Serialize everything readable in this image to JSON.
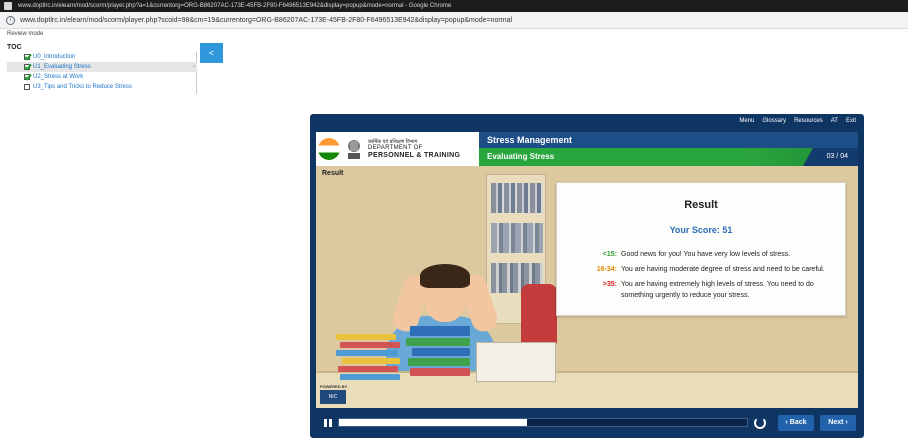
{
  "browser": {
    "window_title": "www.doptlrc.in/elearn/mod/scorm/player.php?a=1&currentorg=ORG-B86207AC-173E-45FB-2F80-F6496513E942&display=popup&mode=normal - Google Chrome",
    "url": "www.doptlrc.in/elearn/mod/scorm/player.php?scoid=98&cm=19&currentorg=ORG-B86207AC-173E-45FB-2F80-F6496513E942&display=popup&mode=normal"
  },
  "review_mode": "Review mode",
  "toc": {
    "heading": "TOC",
    "collapse_label": "<",
    "items": [
      {
        "label": "U0_Introduction",
        "checked": true
      },
      {
        "label": "U1_Evaluating Stress",
        "checked": true
      },
      {
        "label": "U2_Stress at Work",
        "checked": true
      },
      {
        "label": "U3_Tips and Tricks to Reduce Stress",
        "checked": false
      }
    ]
  },
  "player": {
    "nav": [
      "Menu",
      "Glossary",
      "Resources",
      "AT",
      "Exit"
    ],
    "dept_hindi": "कार्मिक एवं प्रशिक्षण विभाग",
    "dept_line1": "DEPARTMENT OF",
    "dept_line2": "PERSONNEL & TRAINING",
    "course_title": "Stress Management",
    "topic_title": "Evaluating Stress",
    "page_counter": "03 / 04",
    "stage_label": "Result",
    "result": {
      "title": "Result",
      "score_label": "Your Score:",
      "score_value": "51",
      "ranges": [
        {
          "range": "<15:",
          "color": "#2e9e2e",
          "text": "Good news for you! You have very low levels of stress."
        },
        {
          "range": "16-34:",
          "color": "#e08a00",
          "text": "You are having moderate degree of stress and need to be careful."
        },
        {
          "range": ">35:",
          "color": "#d42020",
          "text": "You are having extremely high levels of stress. You need to do something urgently to reduce your stress."
        }
      ]
    },
    "powered_by": "POWERED BY",
    "powered_logo": "NIC",
    "progress": 0.46,
    "back_label": "‹ Back",
    "next_label": "Next ›"
  }
}
